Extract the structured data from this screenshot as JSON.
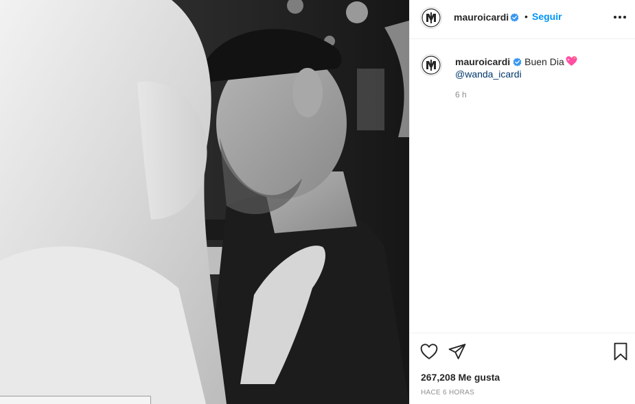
{
  "post": {
    "username": "mauroicardi",
    "follow_label": "Seguir",
    "separator": "•",
    "caption_text": "Buen Dia",
    "caption_mention": "@wanda_icardi",
    "comment_age": "6 h",
    "likes_label": "267,208 Me gusta",
    "timestamp_label": "HACE 6 HORAS"
  },
  "icons": {
    "avatar": "mi-monogram-logo",
    "verified": "verified-badge-icon",
    "more": "more-options-icon",
    "like": "heart-outline-icon",
    "share": "paper-plane-icon",
    "save": "bookmark-icon",
    "emoji": "sparkling-heart-emoji"
  },
  "colors": {
    "accent": "#0095f6",
    "mention": "#00376b",
    "muted": "#8e8e8e",
    "text": "#262626",
    "border": "#efefef",
    "emoji_pink": "#ff4fa3"
  }
}
